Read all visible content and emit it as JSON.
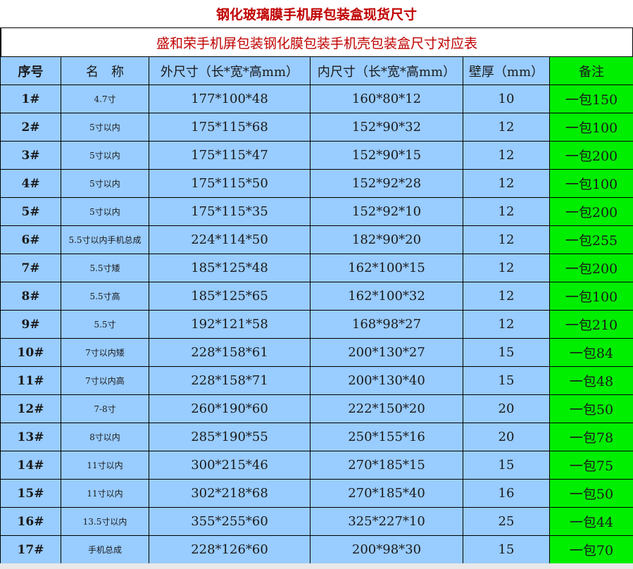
{
  "title": "钢化玻璃膜手机屏包装盒现货尺寸",
  "subtitle": "盛和荣手机屏包装钢化膜包装手机壳包装盒尺寸对应表",
  "headers": {
    "seq": "序号",
    "name": "名　称",
    "outer": "外尺寸（长*宽*高mm）",
    "inner": "内尺寸（长*宽*高mm）",
    "wall": "壁厚（mm）",
    "note": "备注"
  },
  "rows": [
    {
      "seq": "1#",
      "name": "4.7寸",
      "outer": "177*100*48",
      "inner": "160*80*12",
      "wall": "10",
      "note": "一包150"
    },
    {
      "seq": "2#",
      "name": "5寸以内",
      "outer": "175*115*68",
      "inner": "152*90*32",
      "wall": "12",
      "note": "一包100"
    },
    {
      "seq": "3#",
      "name": "5寸以内",
      "outer": "175*115*47",
      "inner": "152*90*15",
      "wall": "12",
      "note": "一包200"
    },
    {
      "seq": "4#",
      "name": "5寸以内",
      "outer": "175*115*50",
      "inner": "152*92*28",
      "wall": "12",
      "note": "一包100"
    },
    {
      "seq": "5#",
      "name": "5寸以内",
      "outer": "175*115*35",
      "inner": "152*92*10",
      "wall": "12",
      "note": "一包200"
    },
    {
      "seq": "6#",
      "name": "5.5寸以内手机总成",
      "outer": "224*114*50",
      "inner": "182*90*20",
      "wall": "12",
      "note": "一包255"
    },
    {
      "seq": "7#",
      "name": "5.5寸矮",
      "outer": "185*125*48",
      "inner": "162*100*15",
      "wall": "12",
      "note": "一包200"
    },
    {
      "seq": "8#",
      "name": "5.5寸高",
      "outer": "185*125*65",
      "inner": "162*100*32",
      "wall": "12",
      "note": "一包100"
    },
    {
      "seq": "9#",
      "name": "5.5寸",
      "outer": "192*121*58",
      "inner": "168*98*27",
      "wall": "12",
      "note": "一包210"
    },
    {
      "seq": "10#",
      "name": "7寸以内矮",
      "outer": "228*158*61",
      "inner": "200*130*27",
      "wall": "15",
      "note": "一包84"
    },
    {
      "seq": "11#",
      "name": "7寸以内高",
      "outer": "228*158*71",
      "inner": "200*130*40",
      "wall": "15",
      "note": "一包48"
    },
    {
      "seq": "12#",
      "name": "7-8寸",
      "outer": "260*190*60",
      "inner": "222*150*20",
      "wall": "20",
      "note": "一包50"
    },
    {
      "seq": "13#",
      "name": "8寸以内",
      "outer": "285*190*55",
      "inner": "250*155*16",
      "wall": "20",
      "note": "一包78"
    },
    {
      "seq": "14#",
      "name": "11寸以内",
      "outer": "300*215*46",
      "inner": "270*185*15",
      "wall": "15",
      "note": "一包75"
    },
    {
      "seq": "15#",
      "name": "11寸以内",
      "outer": "302*218*68",
      "inner": "270*185*40",
      "wall": "16",
      "note": "一包50"
    },
    {
      "seq": "16#",
      "name": "13.5寸以内",
      "outer": "355*255*60",
      "inner": "325*227*10",
      "wall": "25",
      "note": "一包44"
    },
    {
      "seq": "17#",
      "name": "手机总成",
      "outer": "228*126*60",
      "inner": "200*98*30",
      "wall": "15",
      "note": "一包70"
    }
  ],
  "colors": {
    "title_text": "#c00000",
    "cell_bg": "#99ccff",
    "note_bg": "#00ee00"
  }
}
